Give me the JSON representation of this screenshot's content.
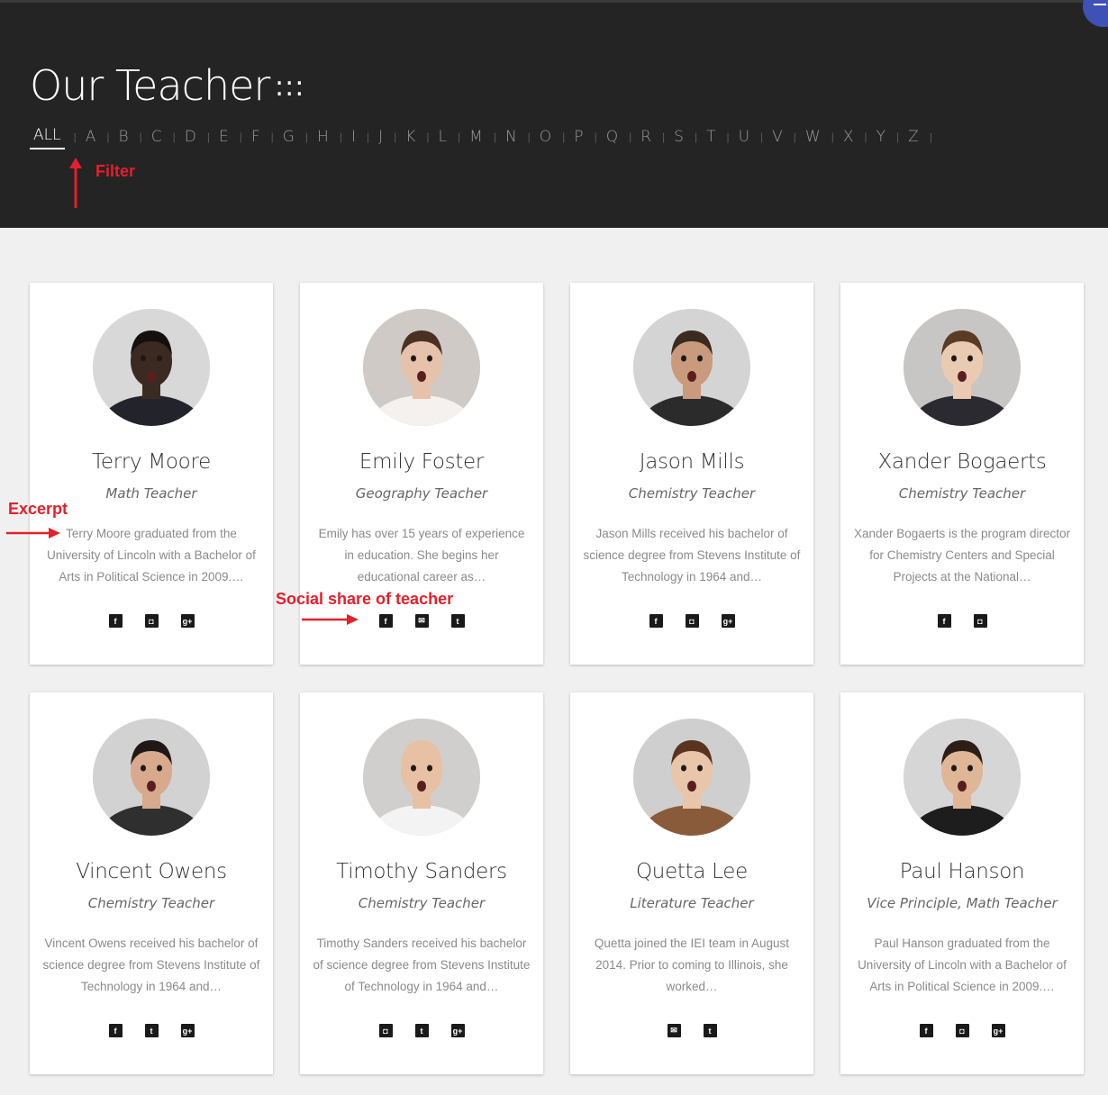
{
  "header": {
    "title": "Our Teacher",
    "title_decoration": ":::",
    "filters": [
      "ALL",
      "A",
      "B",
      "C",
      "D",
      "E",
      "F",
      "G",
      "H",
      "I",
      "J",
      "K",
      "L",
      "M",
      "N",
      "O",
      "P",
      "Q",
      "R",
      "S",
      "T",
      "U",
      "V",
      "W",
      "X",
      "Y",
      "Z"
    ],
    "active_filter": "ALL",
    "separator": "|"
  },
  "annotations": {
    "filter": "Filter",
    "excerpt": "Excerpt",
    "social": "Social share of teacher"
  },
  "teachers": [
    {
      "name": "Terry Moore",
      "role": "Math Teacher",
      "excerpt": "Terry Moore graduated from the University of Lincoln with a Bachelor of Arts in Political Science in 2009.…",
      "socials": [
        "facebook-icon",
        "instagram-icon",
        "google-plus-icon"
      ]
    },
    {
      "name": "Emily Foster",
      "role": "Geography Teacher",
      "excerpt": "Emily has over 15 years of experience in education. She begins her educational career as…",
      "socials": [
        "facebook-icon",
        "email-icon",
        "twitter-icon"
      ]
    },
    {
      "name": "Jason Mills",
      "role": "Chemistry Teacher",
      "excerpt": "Jason Mills received his bachelor of science degree from Stevens Institute of Technology in 1964 and…",
      "socials": [
        "facebook-icon",
        "instagram-icon",
        "google-plus-icon"
      ]
    },
    {
      "name": "Xander Bogaerts",
      "role": "Chemistry Teacher",
      "excerpt": "Xander Bogaerts is the program director for Chemistry Centers and Special Projects at the National…",
      "socials": [
        "facebook-icon",
        "instagram-icon"
      ]
    },
    {
      "name": "Vincent Owens",
      "role": "Chemistry Teacher",
      "excerpt": "Vincent Owens received his bachelor of science degree from Stevens Institute of Technology in 1964 and…",
      "socials": [
        "facebook-icon",
        "twitter-icon",
        "google-plus-icon"
      ]
    },
    {
      "name": "Timothy Sanders",
      "role": "Chemistry Teacher",
      "excerpt": "Timothy Sanders received his bachelor of science degree from Stevens Institute of Technology in 1964 and…",
      "socials": [
        "instagram-icon",
        "twitter-icon",
        "google-plus-icon"
      ]
    },
    {
      "name": "Quetta Lee",
      "role": "Literature Teacher",
      "excerpt": "Quetta joined the IEI team in August 2014. Prior to coming to Illinois, she worked…",
      "socials": [
        "email-icon",
        "twitter-icon"
      ]
    },
    {
      "name": "Paul Hanson",
      "role": "Vice Principle, Math Teacher",
      "excerpt": "Paul Hanson graduated from the University of Lincoln with a Bachelor of Arts in Political Science in 2009.…",
      "socials": [
        "facebook-icon",
        "instagram-icon",
        "google-plus-icon"
      ]
    }
  ],
  "avatar_colors": [
    {
      "bg": "#d8d8d8",
      "skin": "#3b2a22",
      "hair": "#141010",
      "shirt": "#23232b"
    },
    {
      "bg": "#cfcac6",
      "skin": "#e6c2ab",
      "hair": "#4a2f22",
      "shirt": "#f4f1ee"
    },
    {
      "bg": "#d4d4d4",
      "skin": "#c99a7c",
      "hair": "#3a2a20",
      "shirt": "#2b2b2b"
    },
    {
      "bg": "#c8c6c4",
      "skin": "#eacbb2",
      "hair": "#5a3b23",
      "shirt": "#2a2a30"
    },
    {
      "bg": "#d2d2d2",
      "skin": "#d8a98c",
      "hair": "#1f1814",
      "shirt": "#2f2f2f"
    },
    {
      "bg": "#d0cfce",
      "skin": "#e8c0a4",
      "hair": "#e8c0a4",
      "shirt": "#f3f3f3"
    },
    {
      "bg": "#cfcfcf",
      "skin": "#e9c5aa",
      "hair": "#5a3420",
      "shirt": "#8a5b3a"
    },
    {
      "bg": "#d6d6d6",
      "skin": "#dfb696",
      "hair": "#2c1e14",
      "shirt": "#1d1d1d"
    }
  ],
  "icon_glyphs": {
    "facebook-icon": "f",
    "instagram-icon": "◘",
    "google-plus-icon": "g+",
    "email-icon": "✉",
    "twitter-icon": "t"
  }
}
